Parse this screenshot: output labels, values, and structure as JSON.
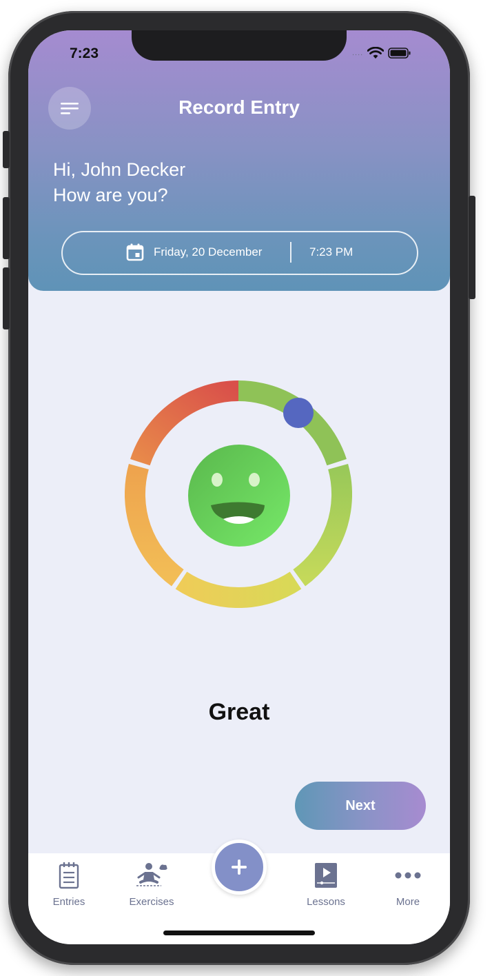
{
  "status_bar": {
    "time": "7:23",
    "signal_text": "....",
    "wifi_icon": "wifi-icon",
    "battery_icon": "battery-icon"
  },
  "header": {
    "menu_icon": "menu-icon",
    "title": "Record Entry",
    "greeting_line1": "Hi, John Decker",
    "greeting_line2": "How are you?",
    "date_icon": "calendar-icon",
    "date": "Friday, 20 December",
    "time": "7:23 PM"
  },
  "mood": {
    "label": "Great",
    "face_icon": "smiling-face-icon",
    "slider_level": 0.08,
    "ring_colors": [
      "#8fc257",
      "#d9504a",
      "#e88a4a",
      "#f2bd56",
      "#e5d355",
      "#b9d65a"
    ]
  },
  "actions": {
    "next_label": "Next"
  },
  "tabbar": {
    "items": [
      {
        "label": "Entries",
        "icon": "notepad-icon"
      },
      {
        "label": "Exercises",
        "icon": "meditation-icon"
      },
      {
        "label": "Lessons",
        "icon": "video-lesson-icon"
      },
      {
        "label": "More",
        "icon": "more-dots-icon"
      }
    ],
    "fab_icon": "plus-icon"
  },
  "colors": {
    "accent": "#8390c8",
    "header_top": "#a58bd0",
    "header_bottom": "#5f93b7",
    "background": "#eceef8"
  }
}
